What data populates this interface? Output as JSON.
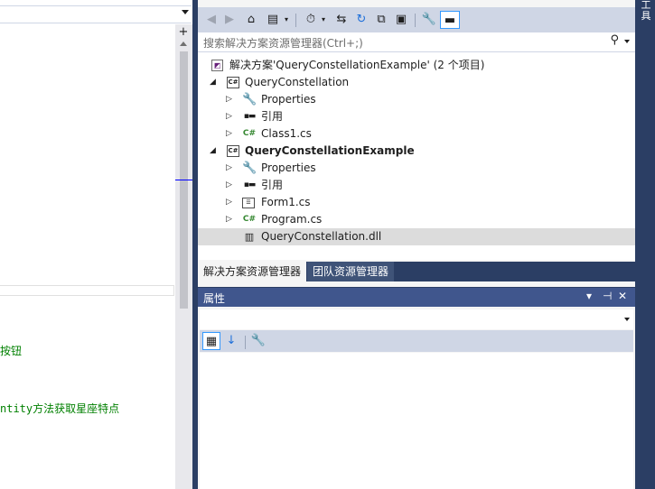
{
  "editor": {
    "split_glyph": "+",
    "code_lines": [
      "按钮",
      "ntity方法获取星座特点"
    ]
  },
  "solution_explorer": {
    "toolbar": [
      {
        "name": "back-icon",
        "glyph": "◀"
      },
      {
        "name": "forward-icon",
        "glyph": "▶"
      },
      {
        "name": "home-icon",
        "glyph": "⌂"
      },
      {
        "name": "switch-views-icon",
        "glyph": "▤"
      },
      {
        "name": "history-icon",
        "glyph": "⏱"
      },
      {
        "name": "sync-icon",
        "glyph": "⇆"
      },
      {
        "name": "refresh-icon",
        "glyph": "↻"
      },
      {
        "name": "collapse-all-icon",
        "glyph": "⧉"
      },
      {
        "name": "show-all-files-icon",
        "glyph": "▣"
      },
      {
        "name": "properties-icon",
        "glyph": "🔧"
      },
      {
        "name": "preview-icon",
        "glyph": "▬"
      }
    ],
    "search_placeholder": "搜索解决方案资源管理器(Ctrl+;)",
    "tree": [
      {
        "label": "解决方案'QueryConstellationExample' (2 个项目)",
        "icon": "solution-icon",
        "glyph": "◩",
        "expander": ""
      },
      {
        "label": "QueryConstellation",
        "icon": "csharp-project-icon",
        "glyph": "C#",
        "expander": "◢"
      },
      {
        "label": "Properties",
        "icon": "wrench-icon",
        "glyph": "🔧",
        "expander": "▷"
      },
      {
        "label": "引用",
        "icon": "references-icon",
        "glyph": "▪▬",
        "expander": "▷"
      },
      {
        "label": "Class1.cs",
        "icon": "csharp-file-icon",
        "glyph": "C#",
        "expander": "▷"
      },
      {
        "label": "QueryConstellationExample",
        "icon": "csharp-project-icon",
        "glyph": "C#",
        "expander": "◢"
      },
      {
        "label": "Properties",
        "icon": "wrench-icon",
        "glyph": "🔧",
        "expander": "▷"
      },
      {
        "label": "引用",
        "icon": "references-icon",
        "glyph": "▪▬",
        "expander": "▷"
      },
      {
        "label": "Form1.cs",
        "icon": "form-icon",
        "glyph": "☰",
        "expander": "▷"
      },
      {
        "label": "Program.cs",
        "icon": "csharp-file-icon",
        "glyph": "C#",
        "expander": "▷"
      },
      {
        "label": "QueryConstellation.dll",
        "icon": "dll-icon",
        "glyph": "▥",
        "expander": ""
      }
    ],
    "tabs": [
      {
        "label": "解决方案资源管理器",
        "active": true
      },
      {
        "label": "团队资源管理器",
        "active": false
      }
    ]
  },
  "properties": {
    "title": "属性",
    "title_buttons": [
      "▾",
      "⊣",
      "✕"
    ],
    "toolbar": [
      {
        "name": "categorized-icon",
        "glyph": "▦"
      },
      {
        "name": "alphabetical-icon",
        "glyph": "↓"
      },
      {
        "name": "property-pages-icon",
        "glyph": "🔧"
      }
    ]
  },
  "right_strip": {
    "label": "工具"
  }
}
